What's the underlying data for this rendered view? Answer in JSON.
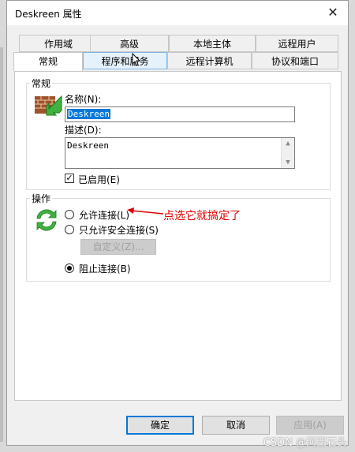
{
  "window": {
    "title": "Deskreen 属性",
    "close_glyph": "✕"
  },
  "tabs_row1": [
    "作用域",
    "高级",
    "本地主体",
    "远程用户"
  ],
  "tabs_row2": [
    "常规",
    "程序和服务",
    "远程计算机",
    "协议和端口"
  ],
  "general": {
    "group_label": "常规",
    "name_label": "名称(N):",
    "name_value": "Deskreen",
    "desc_label": "描述(D):",
    "desc_value": "Deskreen",
    "enabled_label": "已启用(E)",
    "enabled": true
  },
  "action": {
    "group_label": "操作",
    "allow_label": "允许连接(L)",
    "secure_label": "只允许安全连接(S)",
    "customize_label": "自定义(Z)...",
    "block_label": "阻止连接(B)",
    "selected": "block"
  },
  "annotation": {
    "text": "点选它就搞定了",
    "color": "#e00000"
  },
  "buttons": {
    "ok": "确定",
    "cancel": "取消",
    "apply": "应用(A)"
  },
  "watermark": "CSDN @河西石头",
  "colors": {
    "accent": "#0078d7",
    "annotation": "#e00000"
  }
}
